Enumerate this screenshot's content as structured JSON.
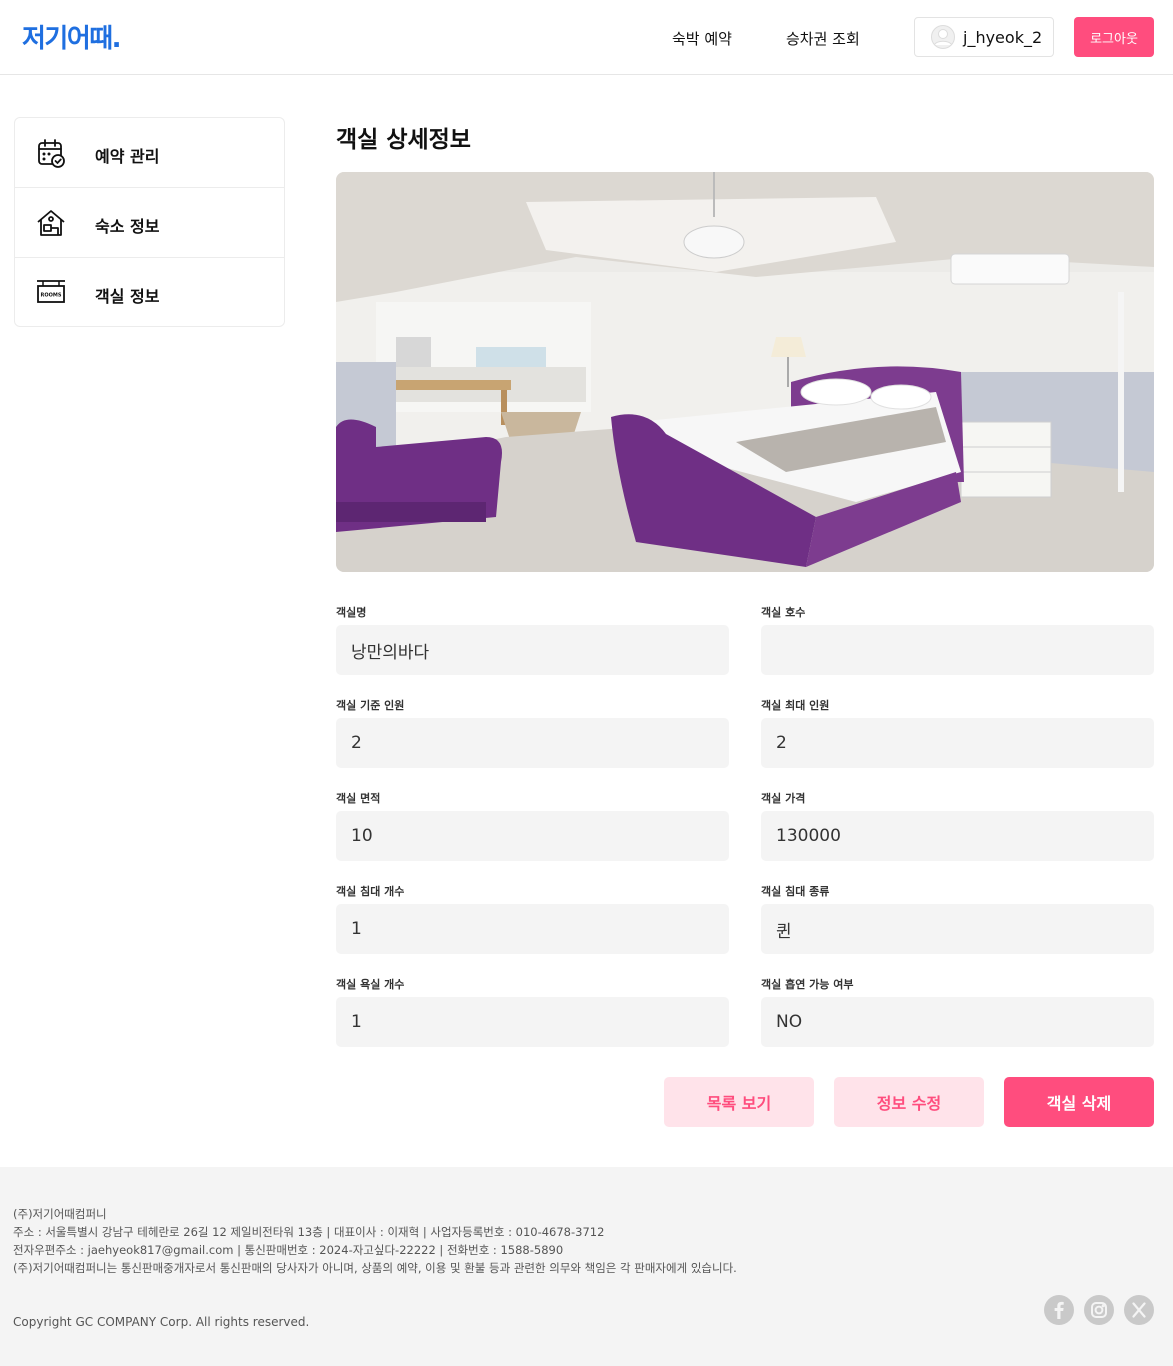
{
  "header": {
    "logo": "저기어때.",
    "nav": [
      "숙박 예약",
      "승차권 조회"
    ],
    "username": "j_hyeok_2",
    "logout_label": "로그아웃"
  },
  "sidebar": {
    "items": [
      {
        "label": "예약 관리",
        "icon": "calendar-check-icon"
      },
      {
        "label": "숙소 정보",
        "icon": "house-icon"
      },
      {
        "label": "객실 정보",
        "icon": "rooms-sign-icon"
      }
    ],
    "rooms_sign_text": "ROOMS"
  },
  "main": {
    "title": "객실 상세정보",
    "fields": [
      {
        "label": "객실명",
        "value": "낭만의바다"
      },
      {
        "label": "객실 호수",
        "value": ""
      },
      {
        "label": "객실 기준 인원",
        "value": "2"
      },
      {
        "label": "객실 최대 인원",
        "value": "2"
      },
      {
        "label": "객실 면적",
        "value": "10"
      },
      {
        "label": "객실 가격",
        "value": "130000"
      },
      {
        "label": "객실 침대 개수",
        "value": "1"
      },
      {
        "label": "객실 침대 종류",
        "value": "퀸"
      },
      {
        "label": "객실 욕실 개수",
        "value": "1"
      },
      {
        "label": "객실 흡연 가능 여부",
        "value": "NO"
      }
    ],
    "buttons": {
      "list": "목록 보기",
      "edit": "정보 수정",
      "delete": "객실 삭제"
    }
  },
  "footer": {
    "lines": [
      "(주)저기어때컴퍼니",
      "주소 : 서울특별시 강남구 테헤란로 26길 12 제일비전타워 13층 | 대표이사 : 이재혁 | 사업자등록번호 : 010-4678-3712",
      "전자우편주소 : jaehyeok817@gmail.com | 통신판매번호 : 2024-자고싶다-22222 | 전화번호 : 1588-5890",
      "(주)저기어때컴퍼니는 통신판매중개자로서 통신판매의 당사자가 아니며, 상품의 예약, 이용 및 환불 등과 관련한 의무와 책임은 각 판매자에게 있습니다."
    ],
    "copyright": "Copyright GC COMPANY Corp. All rights reserved.",
    "social": [
      "facebook-icon",
      "instagram-icon",
      "x-icon"
    ]
  },
  "colors": {
    "brand_blue": "#1f6fe0",
    "accent_pink": "#ff4d7e",
    "accent_pink_light": "#ffe3ea",
    "field_bg": "#f4f4f4"
  }
}
